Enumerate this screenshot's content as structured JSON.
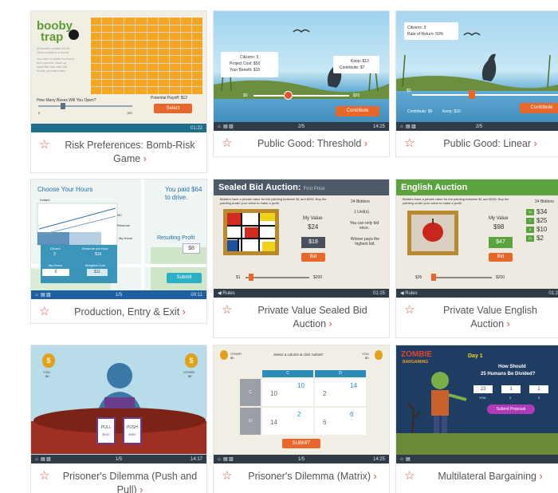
{
  "cards": [
    {
      "title": "Risk Preferences: Bomb-Risk Game",
      "thumb": {
        "logo_line1": "booby",
        "logo_line2": "trap",
        "desc_lines": [
          "64 boxes contain 10-10",
          "Once contains a bomb",
          "You earn a dollar for every",
          "box opened. Blow up",
          "open the box with the",
          "bomb, you earn zero"
        ],
        "slider_label": "How Many Boxes Will You Open?",
        "payoff_label": "Potential Payoff: $12",
        "select_label": "Select",
        "slider_min": "0",
        "slider_max": "100",
        "timer": "01:22"
      }
    },
    {
      "title": "Public Good: Threshold",
      "thumb": {
        "citizens": "Citizens: 5",
        "project_cost": "Project Cost: $50",
        "benefit": "Your Benefit: $15",
        "keep": "Keep: $13",
        "contribute_val": "Contribute: $7",
        "min": "$0",
        "max": "$20",
        "button": "Contribute",
        "page": "2/5",
        "timer": "14:25"
      }
    },
    {
      "title": "Public Good: Linear",
      "thumb": {
        "citizens": "Citizens: 3",
        "rate": "Rate of Return: 50%",
        "min": "$0",
        "contribute_val": "Contribute: $6",
        "keep": "Keep: $10",
        "button": "Contribute",
        "page": "2/5"
      }
    },
    {
      "title": "Production, Entry & Exit",
      "thumb": {
        "heading": "Choose Your Hours",
        "paid": "You paid $64 to drive.",
        "dollars": "Dollars",
        "mc": "MC",
        "revenue": "Revenue",
        "my_hours": "My Hours",
        "profit_label": "Resulting Profit",
        "profit": "$8",
        "drivers_label": "Drivers",
        "drivers": "3",
        "rev_hour_label": "Revenue per Hour",
        "rev_hour": "$16",
        "hours_label": "My Hours",
        "hours": "6",
        "mc_label": "Marginal Cost",
        "mc_val": "$11",
        "submit": "Submit",
        "page": "1/5",
        "timer": "00:11"
      }
    },
    {
      "title": "Private Value Sealed Bid Auction",
      "thumb": {
        "heading": "Sealed Bid Auction:",
        "sub": "First Price",
        "intro": "Bidders have a private value for the painting between $1 and $200. Buy the painting under your value to make a profit.",
        "bidders": "24 Bidders",
        "units": "1 Unit(s)",
        "once": "You can only bid once.",
        "winner": "Winner pays the highest bid.",
        "my_value_label": "My Value",
        "my_value": "$24",
        "bid_value": "$18",
        "bid": "Bid",
        "min": "$1",
        "max": "$200",
        "rules": "Rules",
        "timer": "01:25"
      }
    },
    {
      "title": "Private Value English Auction",
      "thumb": {
        "heading": "English Auction",
        "intro": "Bidders have a private value for the painting between $1 and $200. Buy the painting under your value to make a profit.",
        "bidders": "24 Bidders",
        "my_value_label": "My Value",
        "my_value": "$98",
        "bid_value": "$47",
        "bid": "Bid",
        "min": "$35",
        "max": "$200",
        "bids": [
          {
            "n": "11",
            "v": "$34"
          },
          {
            "n": "7",
            "v": "$25"
          },
          {
            "n": "5",
            "v": "$10"
          },
          {
            "n": "22",
            "v": "$2"
          }
        ],
        "rules": "Rules",
        "timer": "01:2"
      }
    },
    {
      "title": "Prisoner's Dilemma (Push and Pull)",
      "thumb": {
        "you": "YOU",
        "you_val": "$0",
        "other": "OTHER",
        "other_val": "$0",
        "pull": "PULL",
        "pull_val": "$100",
        "push": "PUSH",
        "push_val": "$400",
        "page": "1/5",
        "timer": "14:17"
      }
    },
    {
      "title": "Prisoner's Dilemma (Matrix)",
      "thumb": {
        "other": "OTHER",
        "other_val": "$0",
        "you": "YOU",
        "you_val": "$0",
        "instruction": "Select a column & click 'submit'",
        "col_c": "C",
        "col_d": "D",
        "row_c": "C",
        "row_d": "D",
        "cells": [
          {
            "a": "10",
            "b": "10"
          },
          {
            "a": "2",
            "b": "14"
          },
          {
            "a": "14",
            "b": "2"
          },
          {
            "a": "6",
            "b": "6"
          }
        ],
        "submit": "SUBMIT",
        "page": "1/5",
        "timer": "14:25"
      }
    },
    {
      "title": "Multilateral Bargaining",
      "thumb": {
        "logo1": "ZOMBIE",
        "logo2": "BARGAINING",
        "day": "Day 1",
        "question1": "How Should",
        "question2": "25 Humans Be Divided?",
        "vals": [
          "23",
          "1",
          "1"
        ],
        "labels": [
          "YOU",
          "2",
          "3"
        ],
        "button": "Submit Proposal"
      }
    }
  ]
}
